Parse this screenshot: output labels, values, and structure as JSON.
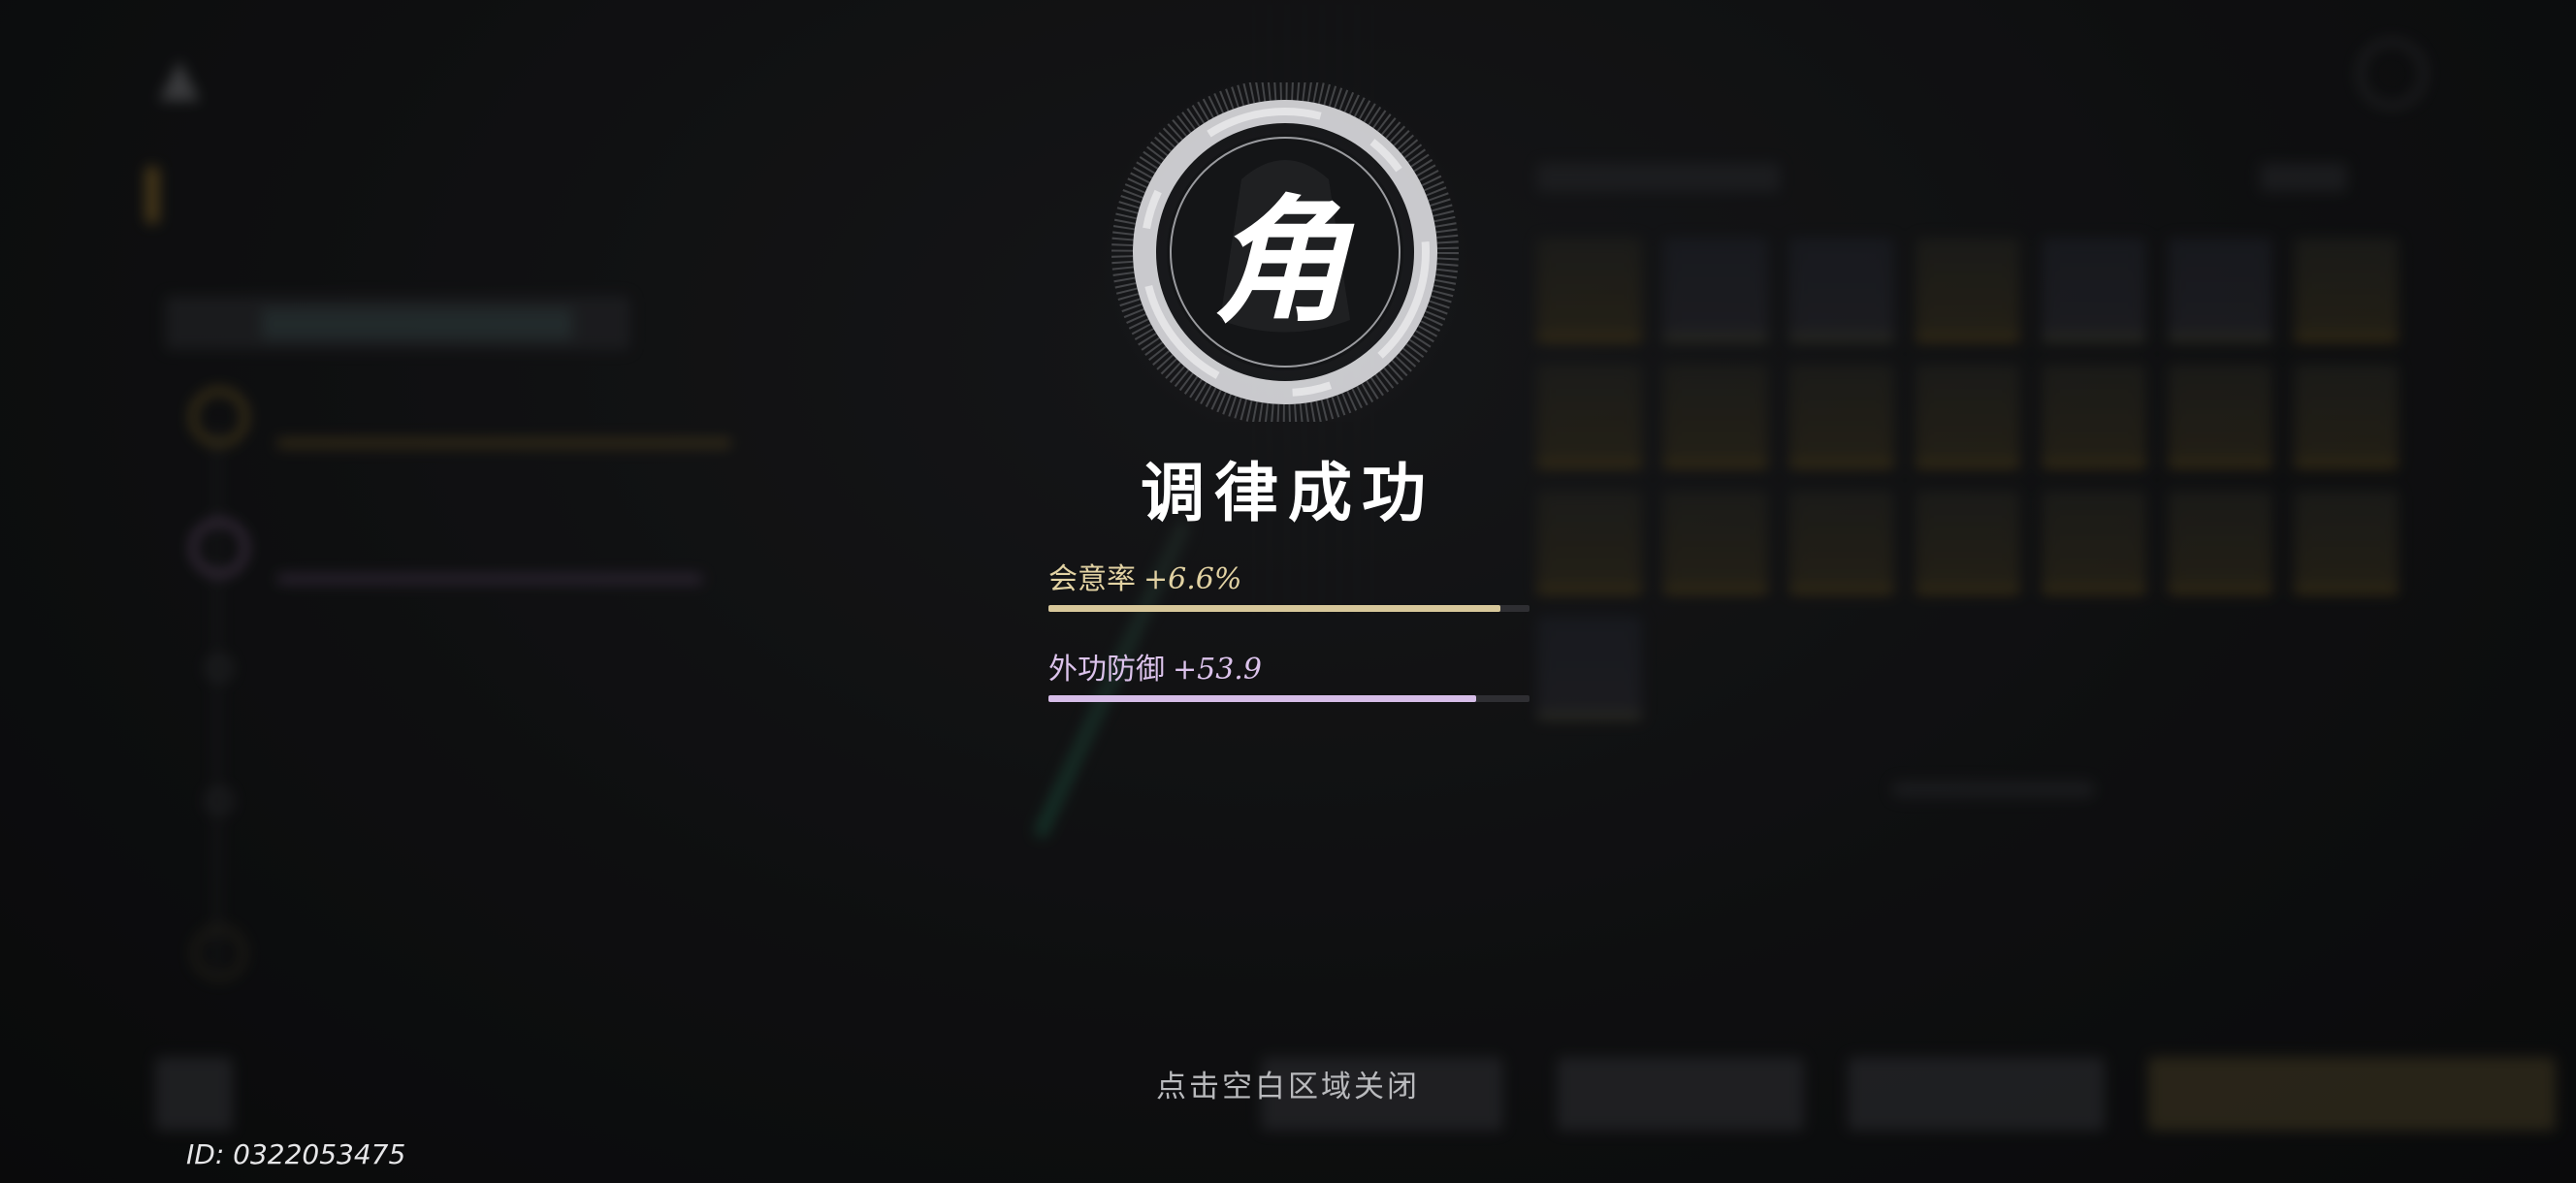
{
  "emblem": {
    "character": "角",
    "icon": "ring-emblem-icon"
  },
  "result": {
    "title": "调律成功"
  },
  "stats": [
    {
      "label": "会意率",
      "value": "+6.6%",
      "fill_percent": 94,
      "color": "#d7c79a"
    },
    {
      "label": "外功防御",
      "value": "+53.9",
      "fill_percent": 89,
      "color": "#d6bde8"
    }
  ],
  "close_hint": "点击空白区域关闭",
  "user_id": "ID: 0322053475"
}
